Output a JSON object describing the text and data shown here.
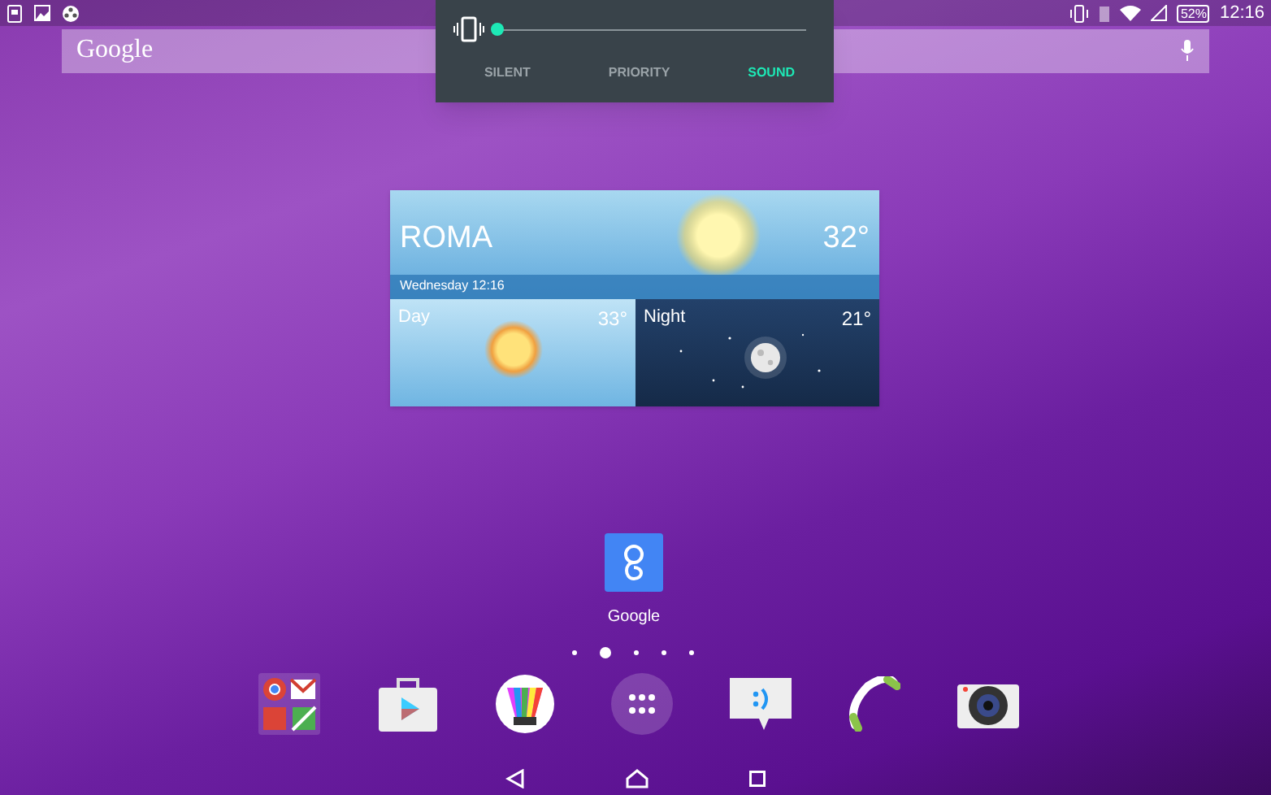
{
  "status_bar": {
    "battery": "52%",
    "time": "12:16"
  },
  "search": {
    "label": "Google"
  },
  "volume_panel": {
    "level": 0,
    "modes": [
      {
        "label": "SILENT",
        "selected": false
      },
      {
        "label": "PRIORITY",
        "selected": false
      },
      {
        "label": "SOUND",
        "selected": true
      }
    ]
  },
  "weather": {
    "city": "ROMA",
    "temp": "32°",
    "date": "Wednesday 12:16",
    "day": {
      "label": "Day",
      "temp": "33°"
    },
    "night": {
      "label": "Night",
      "temp": "21°"
    }
  },
  "home_app": {
    "label": "Google"
  },
  "page_dots": [
    {
      "selected": false
    },
    {
      "selected": true
    },
    {
      "selected": false
    },
    {
      "selected": false
    },
    {
      "selected": false
    }
  ]
}
